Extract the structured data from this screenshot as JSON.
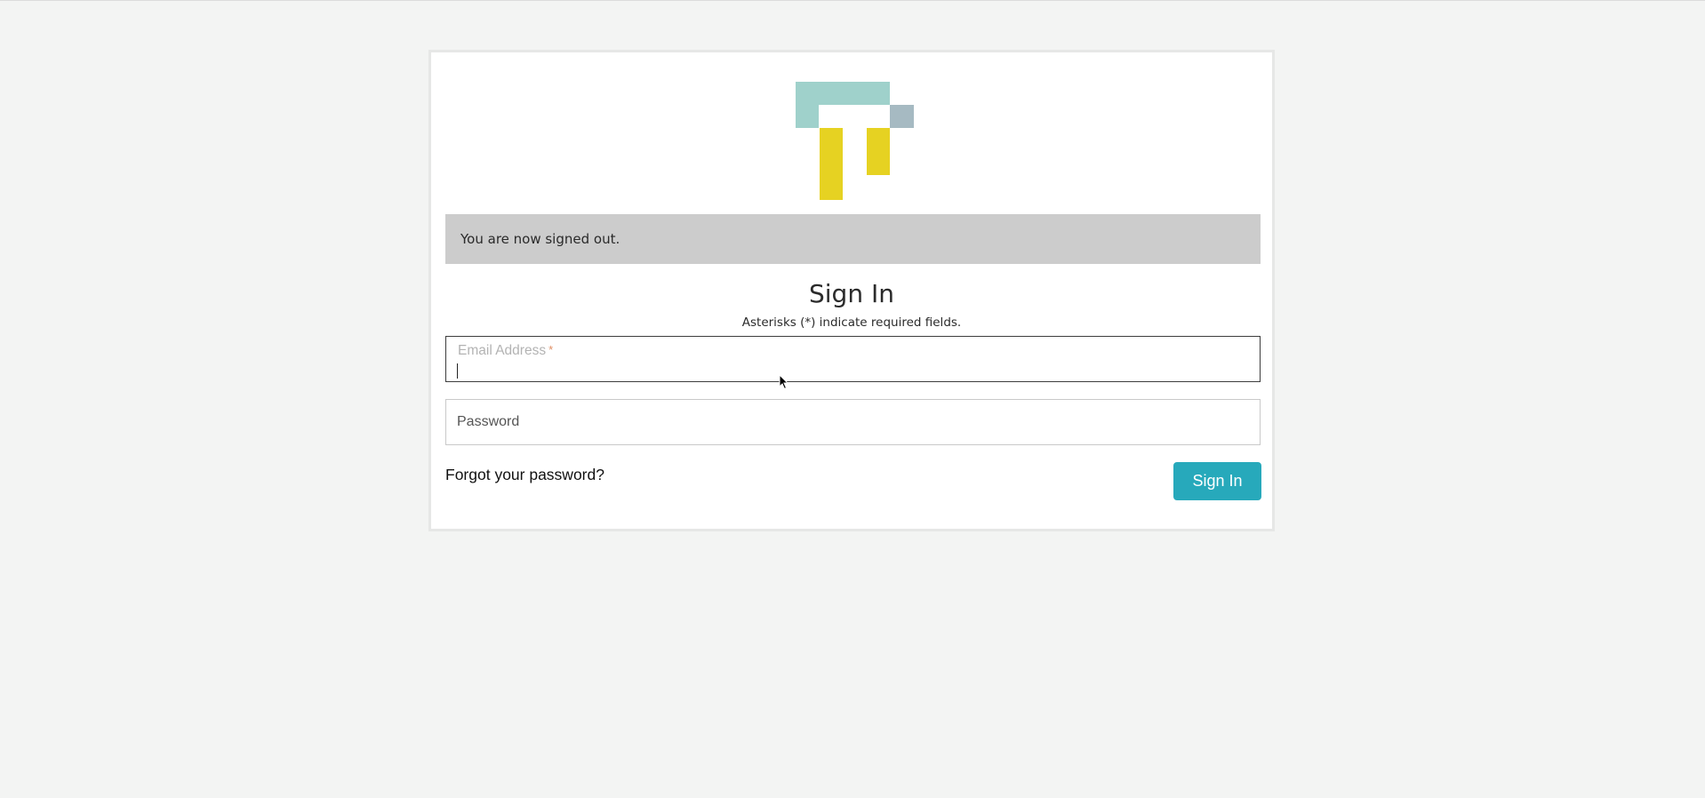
{
  "flash": {
    "message": "You are now signed out."
  },
  "form": {
    "title": "Sign In",
    "subtitle": "Asterisks (*) indicate required fields.",
    "email": {
      "label": "Email Address",
      "required_mark": "*",
      "value": ""
    },
    "password": {
      "placeholder": "Password",
      "value": ""
    },
    "forgot_link": "Forgot your password?",
    "submit_label": "Sign In"
  },
  "colors": {
    "background": "#f3f4f3",
    "card": "#ffffff",
    "flash_bg": "#cccccc",
    "button": "#27a9bb",
    "logo_teal": "#9fd1cb",
    "logo_grey": "#a6bac2",
    "logo_yellow": "#e6d222",
    "required_mark": "#e08f64"
  },
  "icons": {
    "logo": "brand-logo",
    "pointer": "mouse-pointer-icon"
  }
}
